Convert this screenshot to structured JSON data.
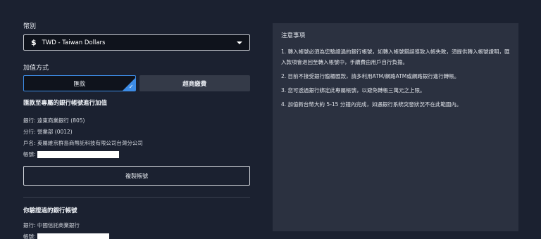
{
  "currency": {
    "label": "幣別",
    "symbol": "$",
    "selected": "TWD - Taiwan Dollars"
  },
  "method": {
    "label": "加值方式",
    "options": [
      "匯款",
      "超商繳費"
    ],
    "selected": 0
  },
  "transfer": {
    "title": "匯款至專屬的銀行帳號進行加值",
    "bank": "銀行: 遠東商業銀行 (805)",
    "branch": "分行: 營業部 (0012)",
    "holder": "戶名: 英屬維京群島商幣託科技有限公司台灣分公司",
    "account_label": "帳號:",
    "copy_button": "複製帳號"
  },
  "verified": {
    "title": "你驗證過的銀行帳號",
    "bank": "銀行: 中國信託商業銀行",
    "account_label": "帳號:"
  },
  "notes": {
    "title": "注意事項",
    "items": [
      "1. 轉入帳號必須為您驗證過的銀行帳號，如轉入帳號錯誤導致入帳失敗，須提供轉入帳號證明，匯入款項會退回至轉入帳號中，手續費由用戶自行負擔。",
      "2. 目前不接受銀行臨櫃匯款，請多利用ATM/網路ATM或網路銀行進行轉帳。",
      "3. 您可透過銀行綁定此專屬帳號，以避免轉帳三萬元之上限。",
      "4. 加值新台幣大約 5-15 分鐘內完成，如遇銀行系統突發狀況不在此範圍內。"
    ]
  },
  "colors": {
    "background": "#1b2130",
    "panel": "#2b3140",
    "accent": "#3d8ce6"
  }
}
